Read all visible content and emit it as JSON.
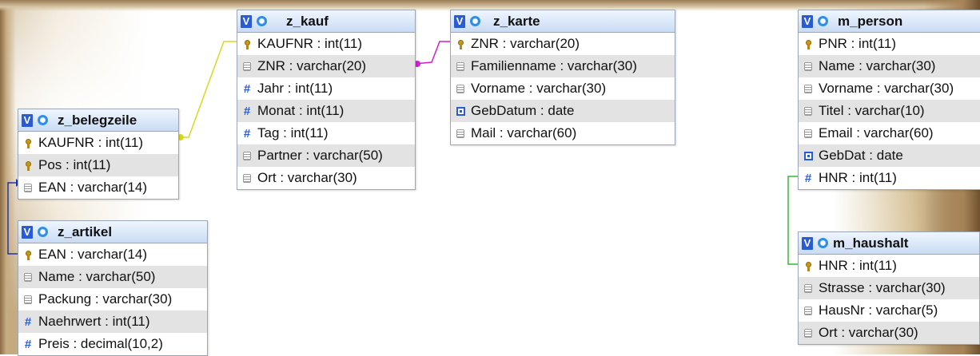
{
  "tables": {
    "z_belegzeile": {
      "name": "z_belegzeile",
      "rows": [
        {
          "icon": "primary-key-icon",
          "text": "KAUFNR : int(11)"
        },
        {
          "icon": "primary-key-icon",
          "text": "Pos : int(11)"
        },
        {
          "icon": "text-column-icon",
          "text": "EAN : varchar(14)"
        }
      ]
    },
    "z_artikel": {
      "name": "z_artikel",
      "rows": [
        {
          "icon": "primary-key-icon",
          "text": "EAN : varchar(14)"
        },
        {
          "icon": "text-column-icon",
          "text": "Name : varchar(50)"
        },
        {
          "icon": "text-column-icon",
          "text": "Packung : varchar(30)"
        },
        {
          "icon": "numeric-column-icon",
          "text": "Naehrwert : int(11)"
        },
        {
          "icon": "numeric-column-icon",
          "text": "Preis : decimal(10,2)"
        }
      ]
    },
    "z_kauf": {
      "name": "z_kauf",
      "rows": [
        {
          "icon": "primary-key-icon",
          "text": "KAUFNR : int(11)"
        },
        {
          "icon": "text-column-icon",
          "text": "ZNR : varchar(20)"
        },
        {
          "icon": "numeric-column-icon",
          "text": "Jahr : int(11)"
        },
        {
          "icon": "numeric-column-icon",
          "text": "Monat : int(11)"
        },
        {
          "icon": "numeric-column-icon",
          "text": "Tag : int(11)"
        },
        {
          "icon": "text-column-icon",
          "text": "Partner : varchar(50)"
        },
        {
          "icon": "text-column-icon",
          "text": "Ort : varchar(30)"
        }
      ]
    },
    "z_karte": {
      "name": "z_karte",
      "rows": [
        {
          "icon": "primary-key-icon",
          "text": "ZNR : varchar(20)"
        },
        {
          "icon": "text-column-icon",
          "text": "Familienname : varchar(30)"
        },
        {
          "icon": "text-column-icon",
          "text": "Vorname : varchar(30)"
        },
        {
          "icon": "date-column-icon",
          "text": "GebDatum : date"
        },
        {
          "icon": "text-column-icon",
          "text": "Mail : varchar(60)"
        }
      ]
    },
    "m_person": {
      "name": "m_person",
      "rows": [
        {
          "icon": "primary-key-icon",
          "text": "PNR : int(11)"
        },
        {
          "icon": "text-column-icon",
          "text": "Name : varchar(30)"
        },
        {
          "icon": "text-column-icon",
          "text": "Vorname : varchar(30)"
        },
        {
          "icon": "text-column-icon",
          "text": "Titel : varchar(10)"
        },
        {
          "icon": "text-column-icon",
          "text": "Email : varchar(60)"
        },
        {
          "icon": "date-column-icon",
          "text": "GebDat : date"
        },
        {
          "icon": "numeric-column-icon",
          "text": "HNR : int(11)"
        }
      ]
    },
    "m_haushalt": {
      "name": "m_haushalt",
      "rows": [
        {
          "icon": "primary-key-icon",
          "text": "HNR : int(11)"
        },
        {
          "icon": "text-column-icon",
          "text": "Strasse : varchar(30)"
        },
        {
          "icon": "text-column-icon",
          "text": "HausNr : varchar(5)"
        },
        {
          "icon": "text-column-icon",
          "text": "Ort : varchar(30)"
        }
      ]
    }
  },
  "header_badge": "V",
  "relation_colors": {
    "belegzeile_kauf": "#d8d820",
    "kauf_karte": "#cc22cc",
    "belegzeile_artikel": "#2233aa",
    "person_haushalt": "#33bb33"
  }
}
